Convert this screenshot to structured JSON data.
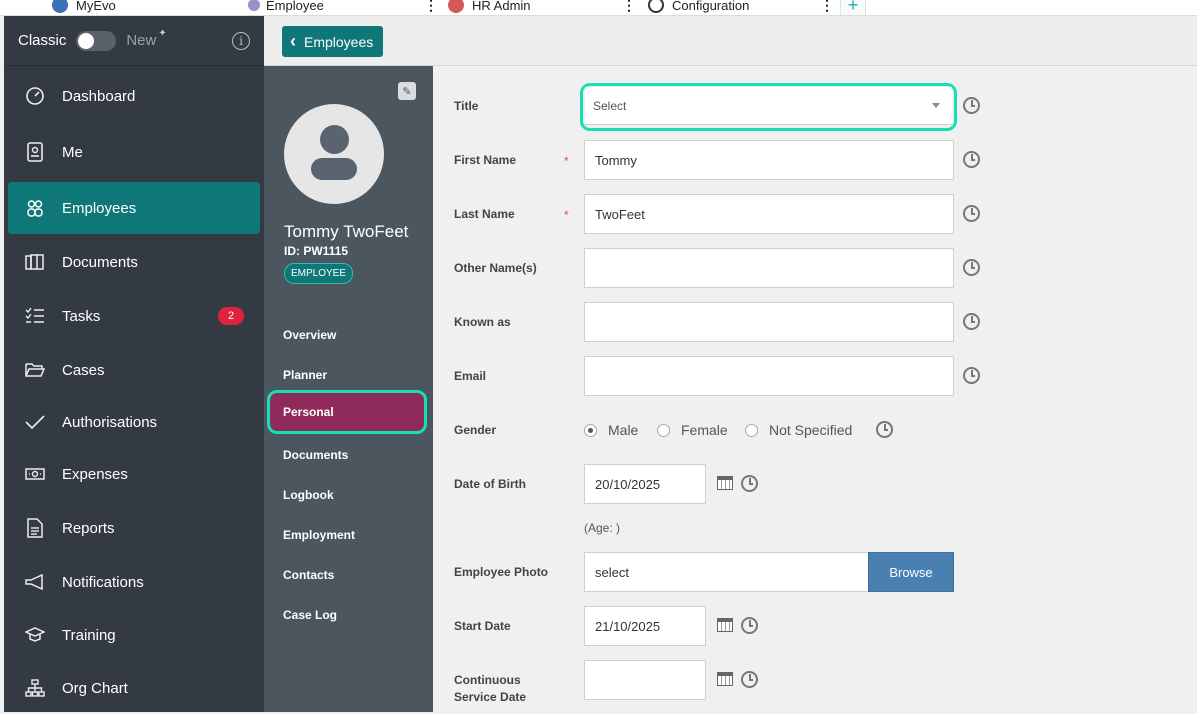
{
  "tabs": [
    {
      "label": "MyEvo",
      "icon": "myevo-icon"
    },
    {
      "label": "Employee",
      "icon": "employee-icon"
    },
    {
      "label": "HR Admin",
      "icon": "hr-admin-icon"
    },
    {
      "label": "Configuration",
      "icon": "gear-icon"
    }
  ],
  "sidebar": {
    "classic_label": "Classic",
    "new_label": "New",
    "items": [
      {
        "label": "Dashboard",
        "icon": "gauge-icon"
      },
      {
        "label": "Me",
        "icon": "id-badge-icon"
      },
      {
        "label": "Employees",
        "icon": "people-icon",
        "active": true
      },
      {
        "label": "Documents",
        "icon": "documents-icon"
      },
      {
        "label": "Tasks",
        "icon": "checklist-icon",
        "badge": "2"
      },
      {
        "label": "Cases",
        "icon": "folder-icon"
      },
      {
        "label": "Authorisations",
        "icon": "check-icon"
      },
      {
        "label": "Expenses",
        "icon": "cash-icon"
      },
      {
        "label": "Reports",
        "icon": "report-icon"
      },
      {
        "label": "Notifications",
        "icon": "megaphone-icon"
      },
      {
        "label": "Training",
        "icon": "graduation-cap-icon"
      },
      {
        "label": "Org Chart",
        "icon": "org-chart-icon"
      }
    ]
  },
  "header": {
    "back_label": "Employees"
  },
  "profile": {
    "name": "Tommy TwoFeet",
    "id_text": "ID: PW1115",
    "badge": "EMPLOYEE",
    "nav": [
      "Overview",
      "Planner",
      "Personal",
      "Documents",
      "Logbook",
      "Employment",
      "Contacts",
      "Case Log"
    ],
    "active_nav": "Personal"
  },
  "form": {
    "title_label": "Title",
    "title_value": "Select",
    "first_name_label": "First Name",
    "first_name_value": "Tommy",
    "last_name_label": "Last Name",
    "last_name_value": "TwoFeet",
    "other_names_label": "Other Name(s)",
    "other_names_value": "",
    "known_as_label": "Known as",
    "known_as_value": "",
    "email_label": "Email",
    "email_value": "",
    "gender_label": "Gender",
    "gender_options": [
      "Male",
      "Female",
      "Not Specified"
    ],
    "gender_selected": "Male",
    "dob_label": "Date of Birth",
    "dob_value": "20/10/2025",
    "age_text": "(Age: )",
    "photo_label": "Employee Photo",
    "photo_value": "select",
    "browse_label": "Browse",
    "start_date_label": "Start Date",
    "start_date_value": "21/10/2025",
    "continuous_label_1": "Continuous",
    "continuous_label_2": "Service Date",
    "continuous_value": "",
    "required_mark": "*"
  },
  "colors": {
    "accent": "#0f7778",
    "highlight": "#14e0b3",
    "active_profile_nav": "#8f2b5a",
    "sidebar_bg": "#343a44",
    "badge": "#e0223c"
  }
}
